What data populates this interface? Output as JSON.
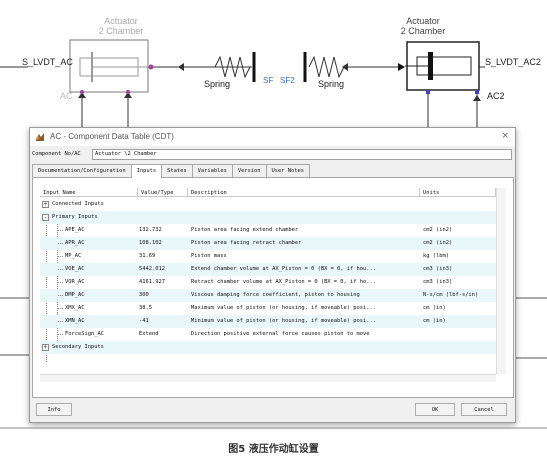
{
  "schematic": {
    "left_actuator_title": [
      "Actuator",
      "2 Chamber"
    ],
    "right_actuator_title": [
      "Actuator",
      "2 Chamber"
    ],
    "port_left": "S_LVDT_AC",
    "port_right": "S_LVDT_AC2",
    "label_ac": "AC",
    "label_ac2": "AC2",
    "spring_left": "Spring",
    "spring_right": "Spring",
    "sf_left": "SF",
    "sf_right": "SF2"
  },
  "dialog": {
    "title": "AC - Component Data Table (CDT)",
    "close_glyph": "×",
    "component_label": "Component No/AC",
    "component_value": "Actuator \\2 Chamber",
    "tabs": [
      {
        "label": "Documentation/Configuration",
        "active": false
      },
      {
        "label": "Inputs",
        "active": true
      },
      {
        "label": "States",
        "active": false
      },
      {
        "label": "Variables",
        "active": false
      },
      {
        "label": "Version",
        "active": false
      },
      {
        "label": "User Notes",
        "active": false
      }
    ],
    "columns": [
      "Input Name",
      "Value/Type",
      "Description",
      "Units"
    ],
    "groups": {
      "connected": {
        "expander": "+",
        "label": "Connected Inputs"
      },
      "primary": {
        "expander": "-",
        "label": "Primary Inputs"
      },
      "secondary": {
        "expander": "+",
        "label": "Secondary Inputs"
      }
    },
    "rows": [
      {
        "name": "APE_AC",
        "value": "132.732",
        "desc": "Piston area facing extend chamber",
        "units": "cm2 (in2)"
      },
      {
        "name": "APR_AC",
        "value": "108.102",
        "desc": "Piston area facing retract chamber",
        "units": "cm2 (in2)"
      },
      {
        "name": "MP_AC",
        "value": "31.69",
        "desc": "Piston mass",
        "units": "kg (lbm)"
      },
      {
        "name": "VOE_AC",
        "value": "5442.012",
        "desc": "Extend chamber volume at AX_Piston = 0 (BX = 0, if hou...",
        "units": "cm3 (in3)"
      },
      {
        "name": "VOR_AC",
        "value": "4161.927",
        "desc": "Retract chamber volume at AX_Piston = 0 (BX = 0, if ho...",
        "units": "cm3 (in3)"
      },
      {
        "name": "DMP_AC",
        "value": "300",
        "desc": "Viscous damping force coefficient, piston to housing",
        "units": "N-s/cm (lbf-s/in)"
      },
      {
        "name": "XMX_AC",
        "value": "38.5",
        "desc": "Maximum value of piston (or housing, if moveable) posi...",
        "units": "cm (in)"
      },
      {
        "name": "XMN_AC",
        "value": "-41",
        "desc": "Minimum value of piston (or housing, if moveable) posi...",
        "units": "cm (in)"
      },
      {
        "name": "ForceSign_AC",
        "value": "Extend",
        "desc": "Direction positive external force causes piston to move",
        "units": ""
      }
    ],
    "buttons": {
      "info": "Info",
      "ok": "OK",
      "cancel": "Cancel"
    }
  },
  "caption": "图5 液压作动缸设置"
}
